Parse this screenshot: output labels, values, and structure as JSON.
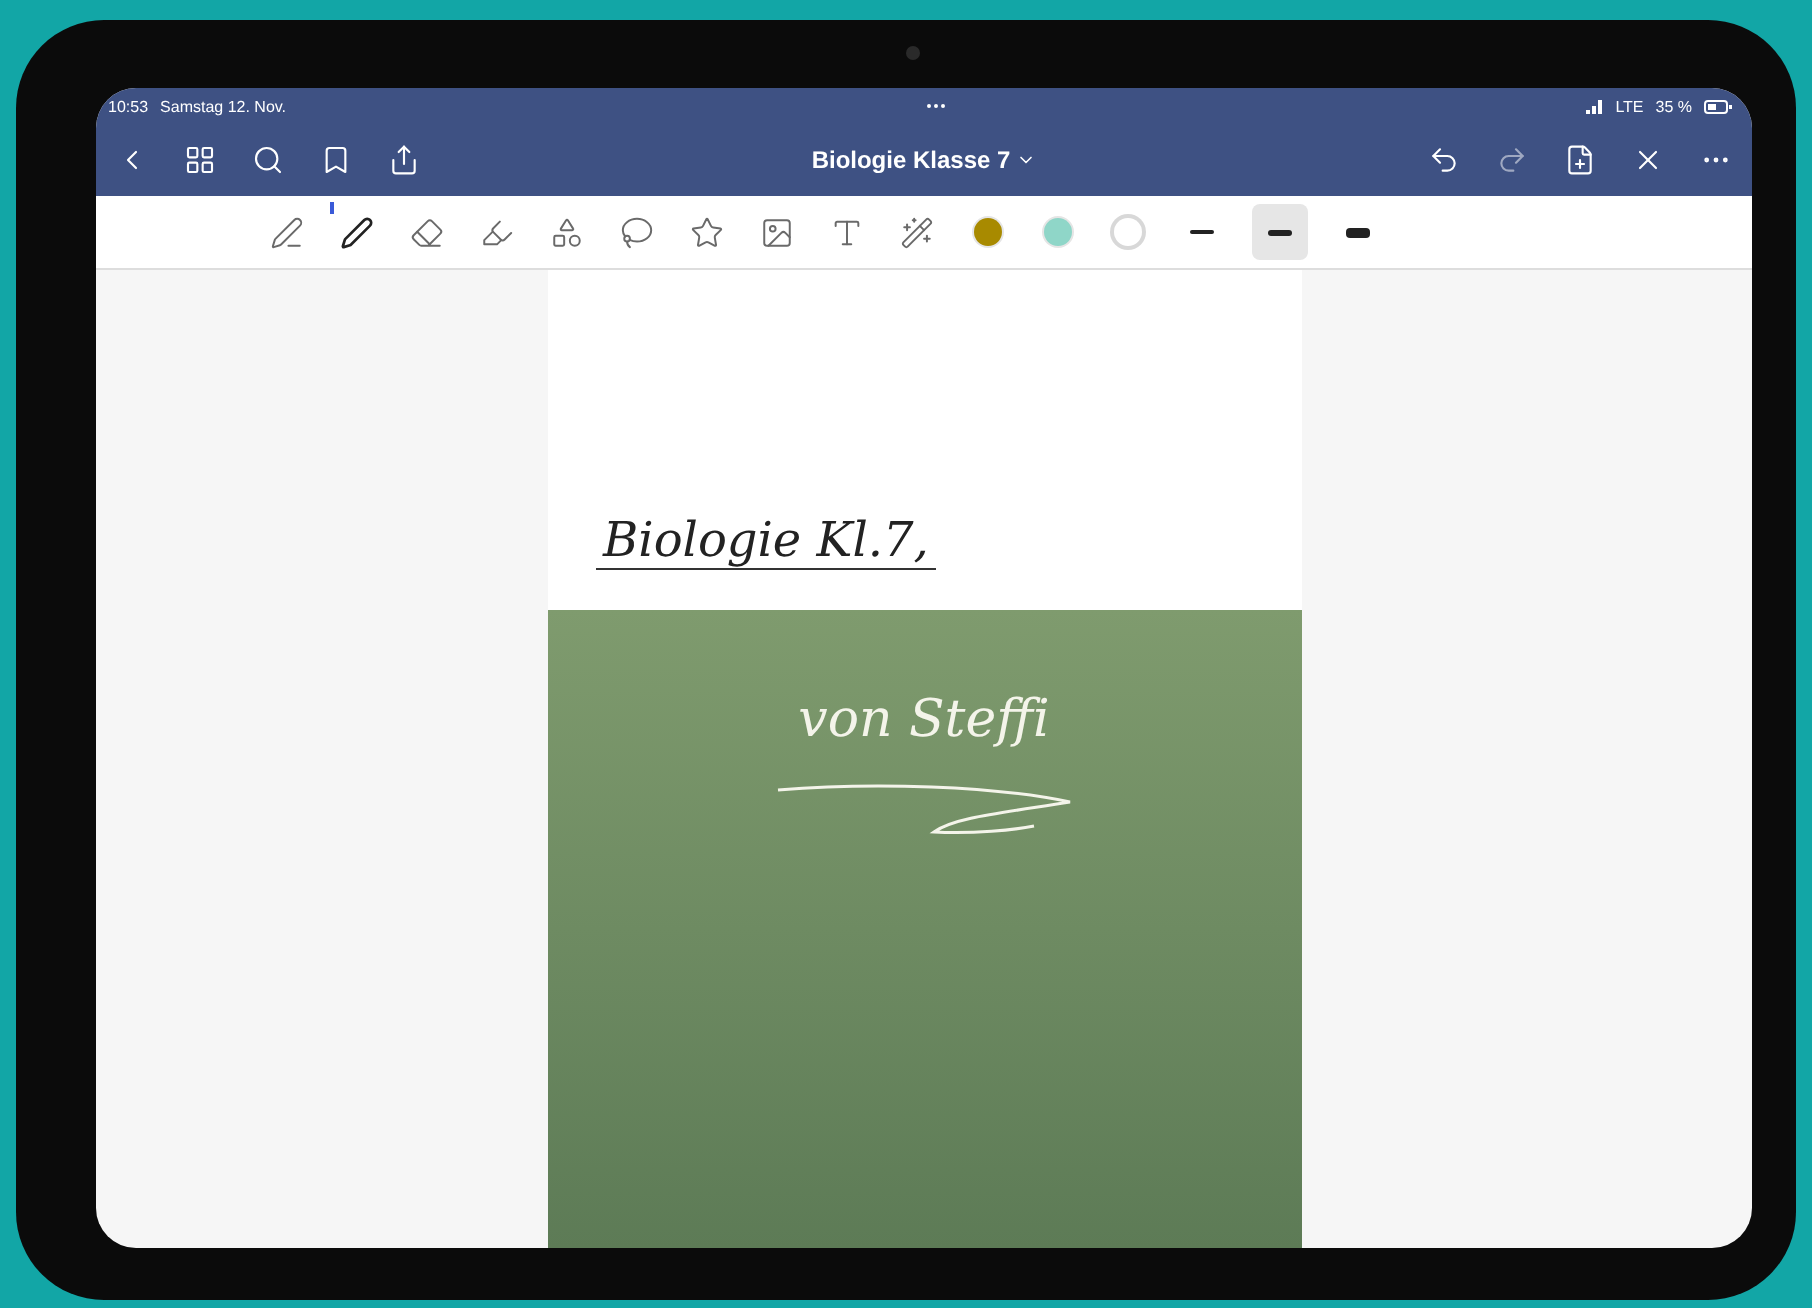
{
  "status_bar": {
    "time": "10:53",
    "date": "Samstag 12. Nov.",
    "network": "LTE",
    "battery": "35 %"
  },
  "nav_bar": {
    "title": "Biologie Klasse 7"
  },
  "tools": [
    {
      "kind": "handwriting",
      "selected": false
    },
    {
      "kind": "pen",
      "selected": true
    },
    {
      "kind": "eraser",
      "selected": false
    },
    {
      "kind": "highlighter",
      "selected": false
    },
    {
      "kind": "shapes",
      "selected": false
    },
    {
      "kind": "lasso",
      "selected": false
    },
    {
      "kind": "sticker",
      "selected": false
    },
    {
      "kind": "image",
      "selected": false
    },
    {
      "kind": "textbox",
      "selected": false
    },
    {
      "kind": "laser",
      "selected": false
    }
  ],
  "colors": [
    {
      "color": "#a88a00",
      "selected": false
    },
    {
      "color": "#8fd6c8",
      "selected": false
    },
    {
      "color": "#ffffff",
      "selected": true
    }
  ],
  "stroke_widths": [
    {
      "kind": "thin",
      "selected": false
    },
    {
      "kind": "medium",
      "selected": true
    },
    {
      "kind": "thick",
      "selected": false
    }
  ],
  "page": {
    "heading": "Biologie Kl.7,",
    "cover_text": "von Steffi"
  }
}
